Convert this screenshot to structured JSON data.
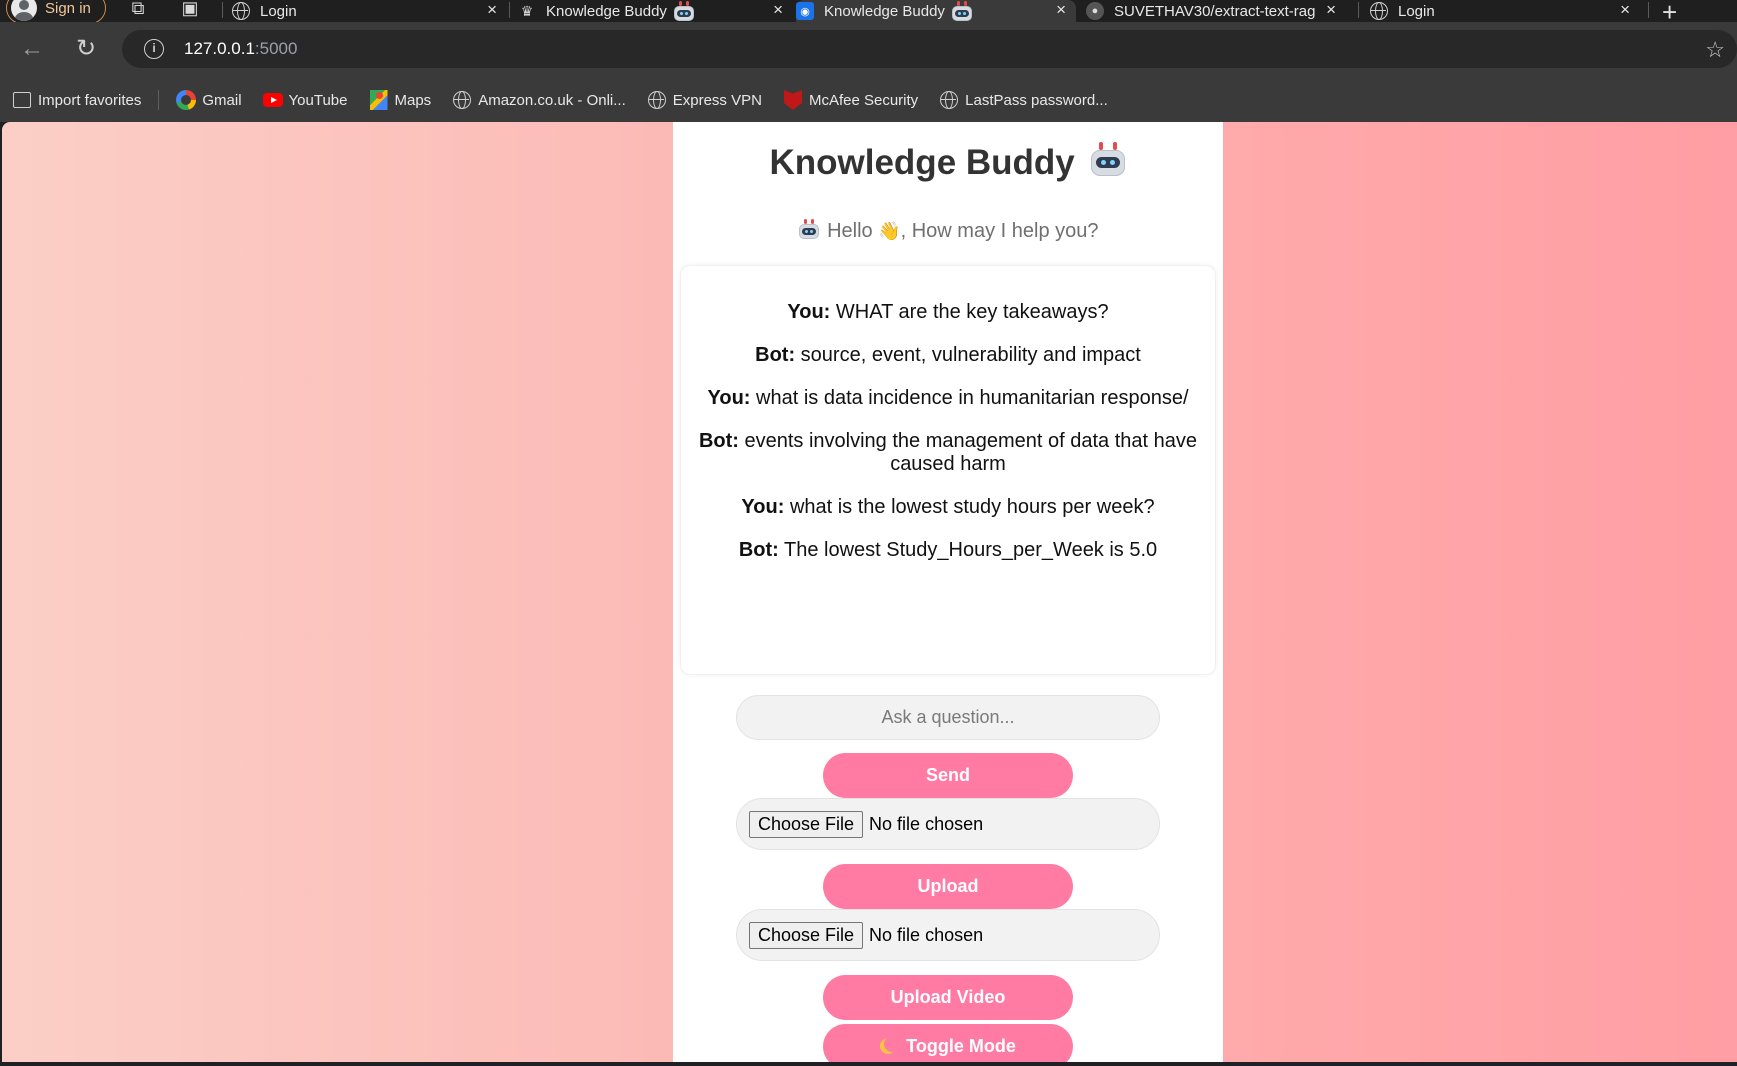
{
  "browser": {
    "signin_label": "Sign in",
    "tabs": [
      {
        "title": "Login",
        "favicon": "globe-icon",
        "active": false
      },
      {
        "title": "Knowledge Buddy",
        "favicon": "crown-icon",
        "active": false
      },
      {
        "title": "Knowledge Buddy",
        "favicon": "app-icon",
        "active": true
      },
      {
        "title": "SUVETHAV30/extract-text-rag",
        "favicon": "github-icon",
        "active": false
      },
      {
        "title": "Login",
        "favicon": "globe-icon",
        "active": false
      }
    ],
    "tab_close": "×",
    "new_tab": "+",
    "url_host": "127.0.0.1",
    "url_port": ":5000",
    "bookmarks": [
      {
        "label": "Import favorites",
        "icon": "import-icon"
      },
      {
        "label": "Gmail",
        "icon": "google-icon"
      },
      {
        "label": "YouTube",
        "icon": "youtube-icon"
      },
      {
        "label": "Maps",
        "icon": "maps-icon"
      },
      {
        "label": "Amazon.co.uk - Onli...",
        "icon": "globe-icon"
      },
      {
        "label": "Express VPN",
        "icon": "globe-icon"
      },
      {
        "label": "McAfee Security",
        "icon": "mcafee-icon"
      },
      {
        "label": "LastPass password...",
        "icon": "globe-icon"
      }
    ]
  },
  "app": {
    "title": "Knowledge Buddy",
    "greeting_hello": "Hello",
    "greeting_rest": ", How may I help you?",
    "messages": [
      {
        "speaker": "You:",
        "text": "WHAT are the key takeaways?"
      },
      {
        "speaker": "Bot:",
        "text": "source, event, vulnerability and impact"
      },
      {
        "speaker": "You:",
        "text": "what is data incidence in humanitarian response/"
      },
      {
        "speaker": "Bot:",
        "text": "events involving the management of data that have caused harm"
      },
      {
        "speaker": "You:",
        "text": "what is the lowest study hours per week?"
      },
      {
        "speaker": "Bot:",
        "text": "The lowest Study_Hours_per_Week is 5.0"
      }
    ],
    "question_placeholder": "Ask a question...",
    "send_label": "Send",
    "choose_file_label": "Choose File",
    "no_file_label": "No file chosen",
    "upload_label": "Upload",
    "upload_video_label": "Upload Video",
    "toggle_mode_label": "Toggle Mode"
  },
  "colors": {
    "accent_button": "#ff7ba4",
    "page_gradient_left": "#fbcfc6",
    "page_gradient_right": "#ff9ea4"
  }
}
